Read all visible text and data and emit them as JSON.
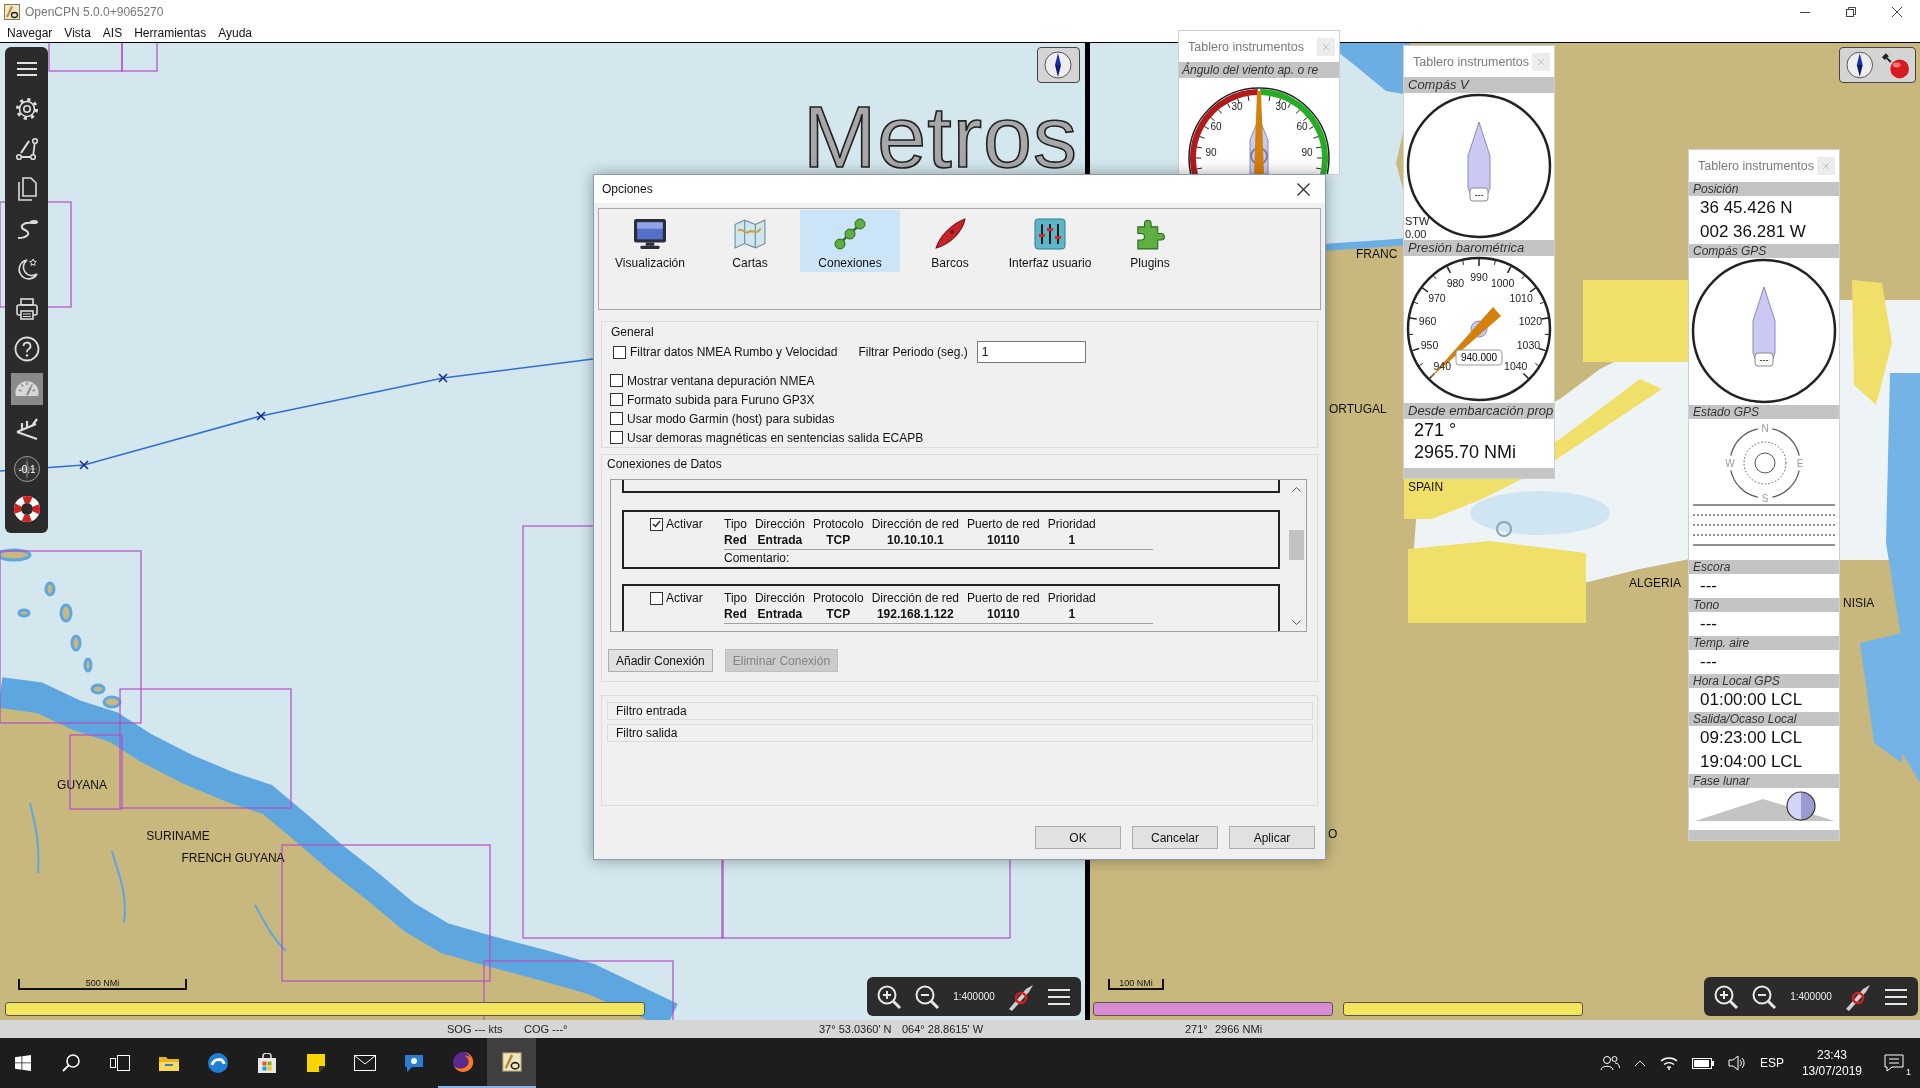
{
  "window": {
    "title": "OpenCPN 5.0.0+9065270"
  },
  "menu": [
    "Navegar",
    "Vista",
    "AIS",
    "Herramientas",
    "Ayuda"
  ],
  "toolbar": [
    {
      "kind": "menu",
      "on": false
    },
    {
      "kind": "settings",
      "on": false
    },
    {
      "kind": "route",
      "on": false
    },
    {
      "kind": "pages",
      "on": false
    },
    {
      "kind": "track",
      "on": false
    },
    {
      "kind": "night",
      "on": false
    },
    {
      "kind": "print",
      "on": false
    },
    {
      "kind": "help",
      "on": false
    },
    {
      "kind": "dashboard",
      "on": true
    },
    {
      "kind": "angle",
      "on": false
    },
    {
      "kind": "compass",
      "on": false,
      "badge": "-0.1"
    },
    {
      "kind": "lifebuoy",
      "on": false
    }
  ],
  "charts": [
    {
      "overlay_title": "Metros",
      "labels": [
        "GUYANA",
        "SURINAME",
        "FRENCH GUYANA"
      ],
      "scale_bar": "500 NMi",
      "zoom_scale": "1:400000",
      "quilt": [
        {
          "color": "#f4e65c"
        }
      ],
      "gps_indicator": false
    },
    {
      "labels": [
        "FRANC",
        "ORTUGAL",
        "SPAIN",
        "ALGERIA",
        "NISIA",
        "O"
      ],
      "scale_bar": "100 NMi",
      "zoom_scale": "1:400000",
      "quilt": [
        {
          "color": "#d98bd4"
        },
        {
          "color": "#f4e65c"
        }
      ],
      "gps_indicator": true
    }
  ],
  "dashboards": [
    {
      "title": "Tablero instrumentos",
      "instruments": [
        {
          "kind": "wind",
          "caption": "Ángulo del viento ap. o re",
          "dial_labels": [
            "30",
            "60",
            "90",
            "30",
            "60",
            "90"
          ]
        }
      ]
    },
    {
      "title": "Tablero instrumentos",
      "instruments": [
        {
          "kind": "compass",
          "caption": "Compás V",
          "heading": "---",
          "corner": [
            "STW",
            "0.00"
          ]
        },
        {
          "kind": "barometer",
          "caption": "Presión barométrica",
          "dial_labels": [
            "940",
            "950",
            "960",
            "970",
            "980",
            "990",
            "1000",
            "1010",
            "1020",
            "1030",
            "1040"
          ],
          "reading": "940.000"
        },
        {
          "kind": "text",
          "caption": "Desde embarcación prop",
          "lines": [
            "271 °",
            "2965.70 NMi"
          ]
        }
      ]
    },
    {
      "title": "Tablero instrumentos",
      "instruments": [
        {
          "kind": "text",
          "caption": "Posición",
          "lines": [
            "36 45.426 N",
            "002 36.281 W"
          ]
        },
        {
          "kind": "compass",
          "caption": "Compás GPS",
          "heading": "---"
        },
        {
          "kind": "gps",
          "caption": "Estado GPS",
          "directions": [
            "N",
            "W",
            "E",
            "S"
          ]
        },
        {
          "kind": "text",
          "caption": "Escora",
          "lines": [
            "---"
          ]
        },
        {
          "kind": "text",
          "caption": "Tono",
          "lines": [
            "---"
          ]
        },
        {
          "kind": "text",
          "caption": "Temp. aire",
          "lines": [
            "---"
          ]
        },
        {
          "kind": "text",
          "caption": "Hora Local GPS",
          "lines": [
            "01:00:00 LCL"
          ]
        },
        {
          "kind": "text",
          "caption": "Salida/Ocaso Local",
          "lines": [
            "09:23:00 LCL",
            "19:04:00 LCL"
          ]
        },
        {
          "kind": "moon",
          "caption": "Fase lunar"
        }
      ]
    }
  ],
  "dialog": {
    "title": "Opciones",
    "categories": [
      {
        "kind": "display",
        "label": "Visualización",
        "selected": false
      },
      {
        "kind": "charts",
        "label": "Cartas",
        "selected": false
      },
      {
        "kind": "connections",
        "label": "Conexiones",
        "selected": true
      },
      {
        "kind": "ships",
        "label": "Barcos",
        "selected": false
      },
      {
        "kind": "interface",
        "label": "Interfaz usuario",
        "selected": false
      },
      {
        "kind": "plugins",
        "label": "Plugins",
        "selected": false
      }
    ],
    "general": {
      "title": "General",
      "options": [
        {
          "label": "Filtrar datos NMEA Rumbo y Velocidad",
          "checked": false
        },
        {
          "label": "Mostrar ventana depuración NMEA",
          "checked": false
        },
        {
          "label": "Formato subida para Furuno GP3X",
          "checked": false
        },
        {
          "label": "Usar modo Garmin (host) para subidas",
          "checked": false
        },
        {
          "label": "Usar demoras magnéticas en sentencias salida ECAPB",
          "checked": false
        }
      ],
      "period": {
        "label": "Filtrar Periodo (seg.)",
        "value": "1"
      }
    },
    "connections": {
      "title": "Conexiones de Datos",
      "items": [
        {
          "enable_label": "Activar",
          "checked": true,
          "columns": [
            "Tipo",
            "Dirección",
            "Protocolo",
            "Dirección de red",
            "Puerto de red",
            "Prioridad"
          ],
          "values": [
            "Red",
            "Entrada",
            "TCP",
            "10.10.10.1",
            "10110",
            "1"
          ],
          "comment_label": "Comentario:"
        },
        {
          "enable_label": "Activar",
          "checked": false,
          "columns": [
            "Tipo",
            "Dirección",
            "Protocolo",
            "Dirección de red",
            "Puerto de red",
            "Prioridad"
          ],
          "values": [
            "Red",
            "Entrada",
            "TCP",
            "192.168.1.122",
            "10110",
            "1"
          ]
        }
      ],
      "actions": [
        {
          "label": "Añadir Conexión",
          "disabled": false
        },
        {
          "label": "Eliminar Conexión",
          "disabled": true
        }
      ]
    },
    "filters": [
      "Filtro entrada",
      "Filtro salida"
    ],
    "buttons": [
      "OK",
      "Cancelar",
      "Aplicar"
    ]
  },
  "status_bar": [
    "SOG --- kts",
    "COG ---°",
    "37° 53.0360' N",
    "064° 28.8615' W",
    "271°",
    "2966 NMi"
  ],
  "taskbar": {
    "apps": [
      {
        "kind": "start",
        "running": false,
        "selected": false
      },
      {
        "kind": "search",
        "running": false,
        "selected": false
      },
      {
        "kind": "task_view",
        "running": false,
        "selected": false
      },
      {
        "kind": "explorer",
        "running": false,
        "selected": false
      },
      {
        "kind": "edge",
        "running": false,
        "selected": false
      },
      {
        "kind": "store",
        "running": false,
        "selected": false
      },
      {
        "kind": "sticky",
        "running": false,
        "selected": false
      },
      {
        "kind": "mail",
        "running": false,
        "selected": false
      },
      {
        "kind": "chat",
        "running": false,
        "selected": false
      },
      {
        "kind": "firefox",
        "running": true,
        "selected": false
      },
      {
        "kind": "opencpn",
        "running": true,
        "selected": true
      }
    ],
    "tray": {
      "language": "ESP",
      "time": "23:43",
      "date": "13/07/2019",
      "notifications": "1"
    }
  }
}
